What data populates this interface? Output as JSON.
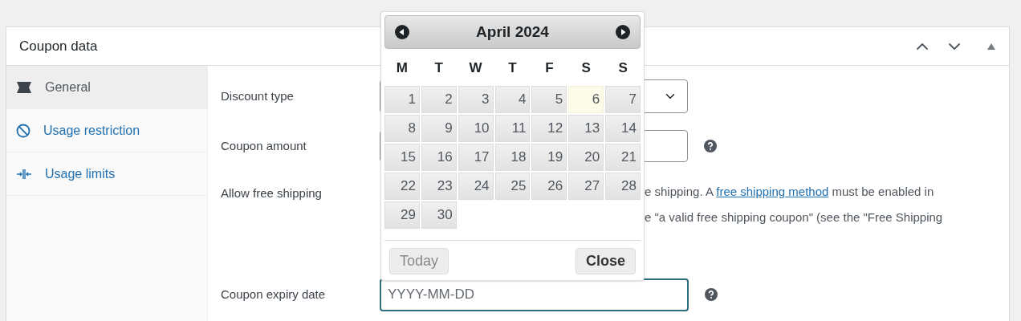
{
  "panel": {
    "title": "Coupon data"
  },
  "tabs": [
    {
      "label": "General",
      "selected": true,
      "kind": "ticket"
    },
    {
      "label": "Usage restriction",
      "selected": false,
      "kind": "ban"
    },
    {
      "label": "Usage limits",
      "selected": false,
      "kind": "limits"
    }
  ],
  "fields": [
    {
      "label": "Discount type",
      "kind": "select",
      "help": false
    },
    {
      "label": "Coupon amount",
      "kind": "input",
      "help": true
    },
    {
      "label": "Allow free shipping",
      "kind": "text",
      "line_1": {
        "before": "e shipping. A ",
        "link": "free shipping method",
        "after": " must be enabled in"
      },
      "line_2": "e \"a valid free shipping coupon\" (see the \"Free Shipping"
    },
    {
      "label": "Coupon expiry date",
      "kind": "date",
      "placeholder": "YYYY-MM-DD",
      "focused": true,
      "help": true
    }
  ],
  "datepicker": {
    "month": "April 2024",
    "weekdays": [
      "M",
      "T",
      "W",
      "T",
      "F",
      "S",
      "S"
    ],
    "weeks": [
      [
        {
          "label": "1",
          "today": false
        },
        {
          "label": "2",
          "today": false
        },
        {
          "label": "3",
          "today": false
        },
        {
          "label": "4",
          "today": false
        },
        {
          "label": "5",
          "today": false
        },
        {
          "label": "6",
          "today": true
        },
        {
          "label": "7",
          "today": false
        }
      ],
      [
        {
          "label": "8",
          "today": false
        },
        {
          "label": "9",
          "today": false
        },
        {
          "label": "10",
          "today": false
        },
        {
          "label": "11",
          "today": false
        },
        {
          "label": "12",
          "today": false
        },
        {
          "label": "13",
          "today": false
        },
        {
          "label": "14",
          "today": false
        }
      ],
      [
        {
          "label": "15",
          "today": false
        },
        {
          "label": "16",
          "today": false
        },
        {
          "label": "17",
          "today": false
        },
        {
          "label": "18",
          "today": false
        },
        {
          "label": "19",
          "today": false
        },
        {
          "label": "20",
          "today": false
        },
        {
          "label": "21",
          "today": false
        }
      ],
      [
        {
          "label": "22",
          "today": false
        },
        {
          "label": "23",
          "today": false
        },
        {
          "label": "24",
          "today": false
        },
        {
          "label": "25",
          "today": false
        },
        {
          "label": "26",
          "today": false
        },
        {
          "label": "27",
          "today": false
        },
        {
          "label": "28",
          "today": false
        }
      ],
      [
        {
          "label": "29",
          "today": false
        },
        {
          "label": "30",
          "today": false
        }
      ]
    ],
    "buttons": [
      {
        "label": "Today",
        "disabled": true
      },
      {
        "label": "Close",
        "disabled": false
      }
    ]
  }
}
